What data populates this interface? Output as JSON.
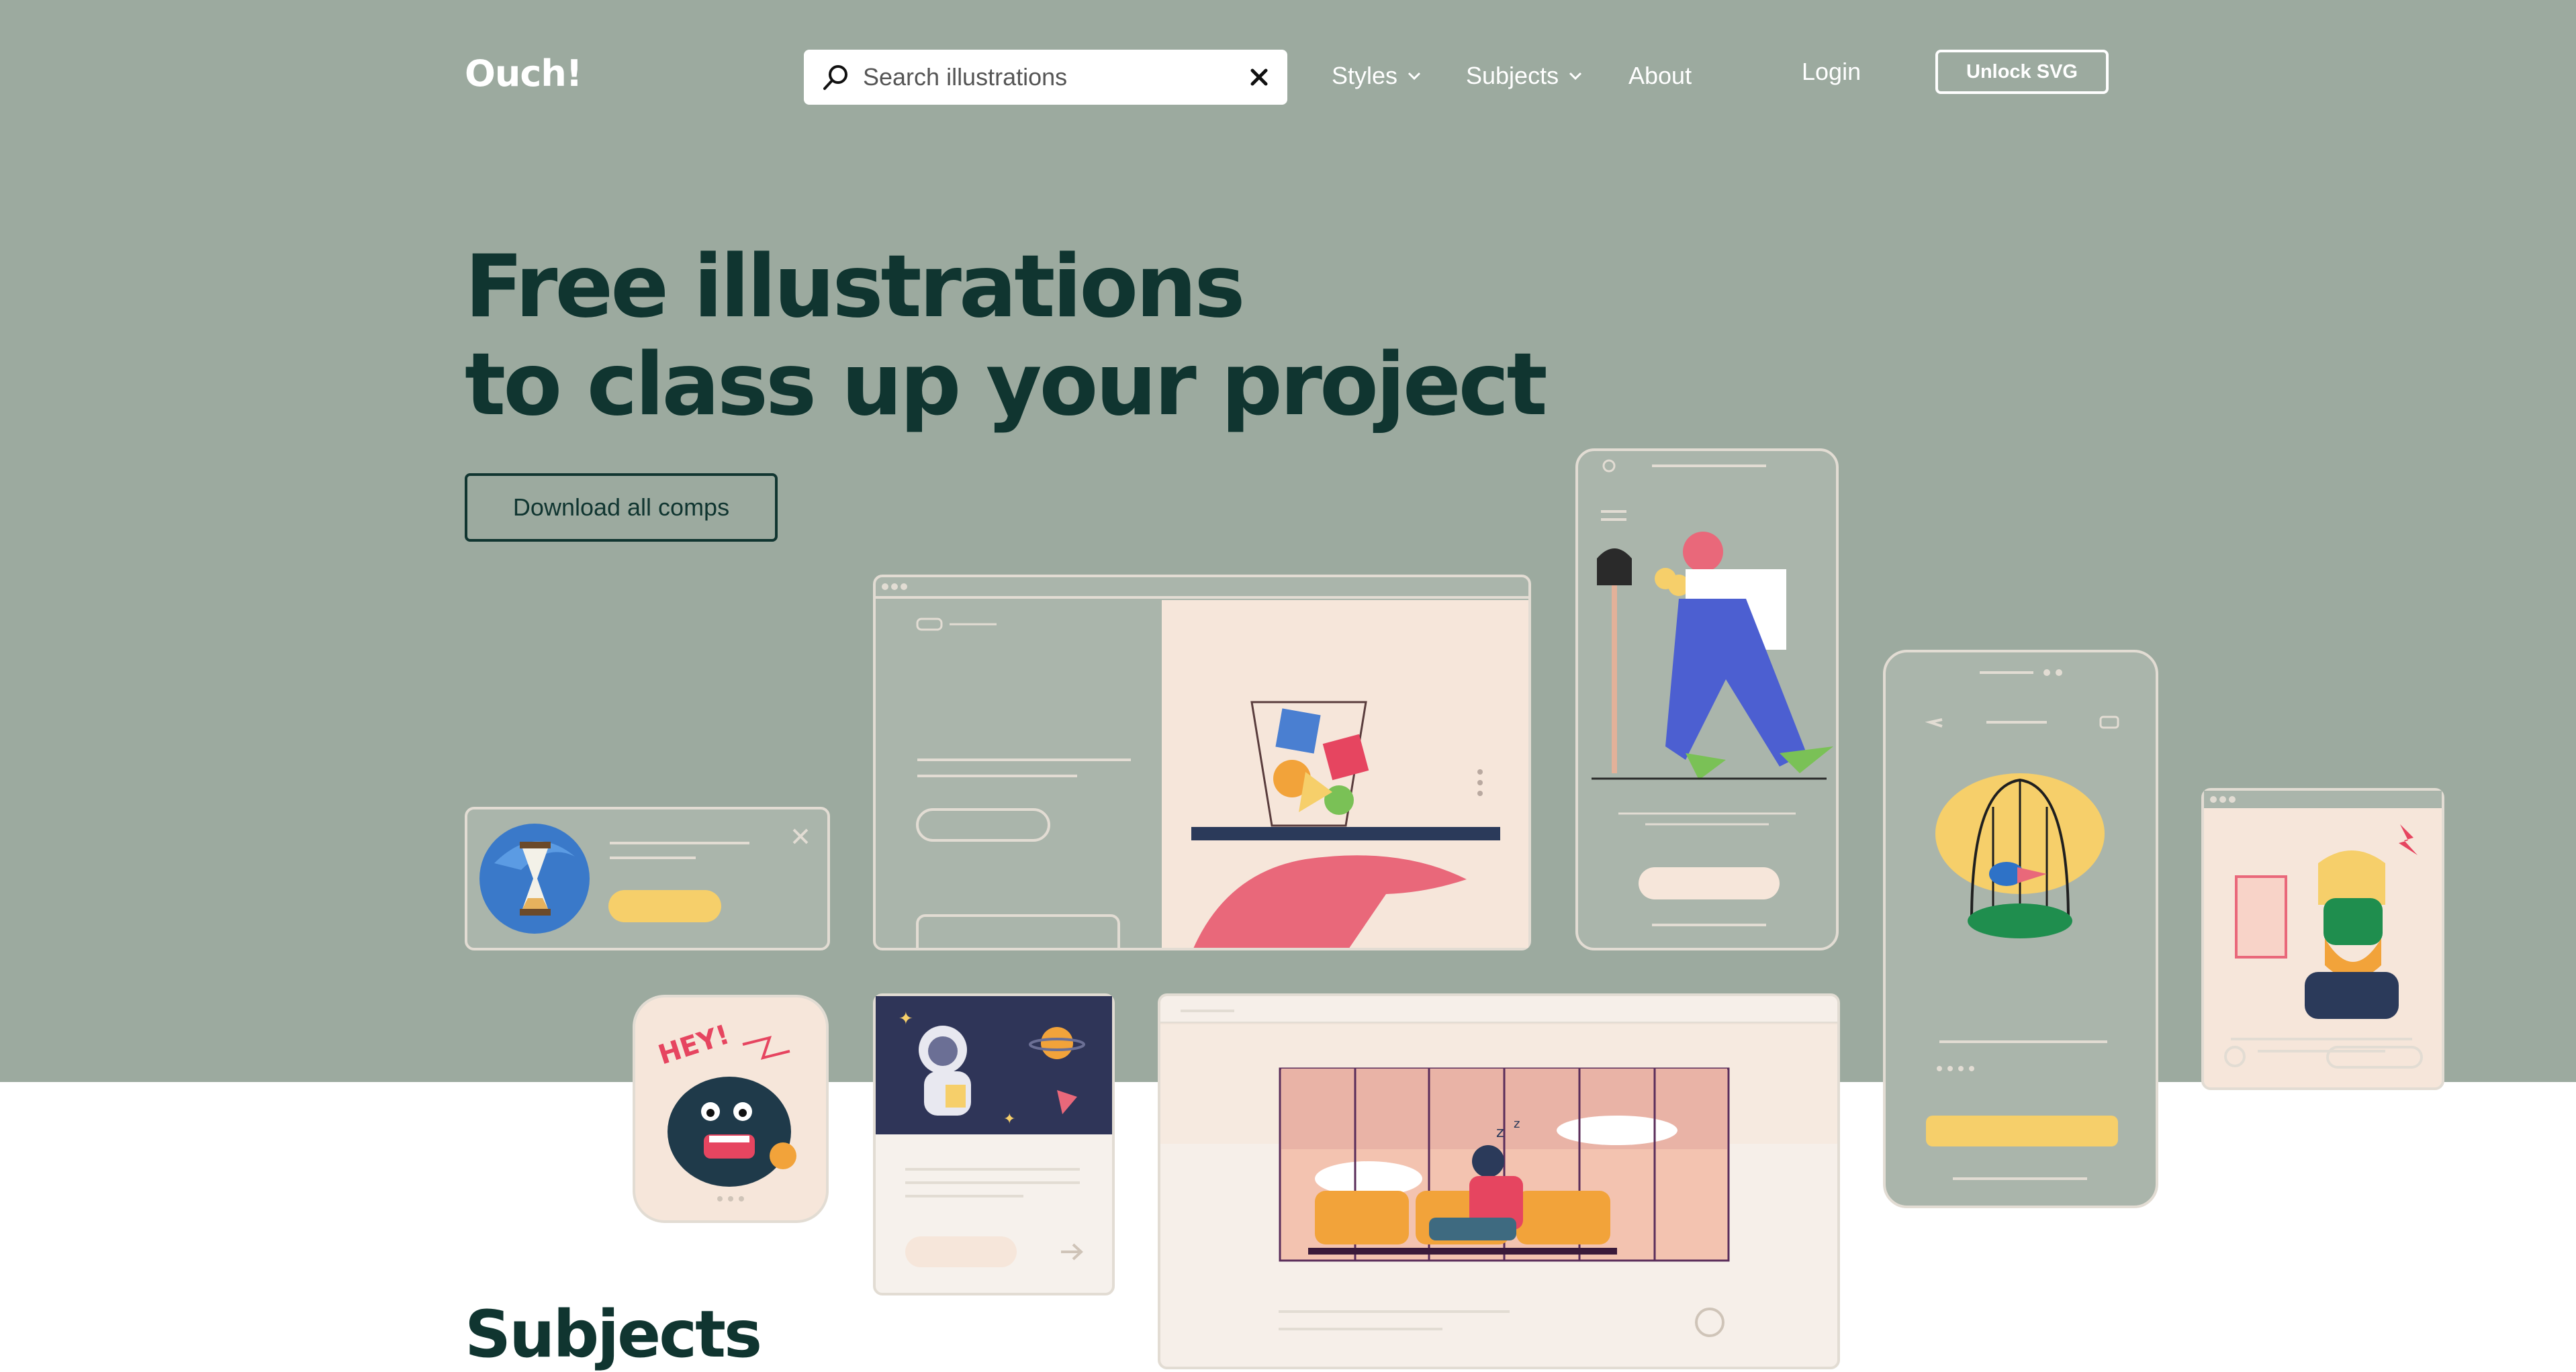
{
  "header": {
    "logo": "Ouch!",
    "search": {
      "placeholder": "Search illustrations",
      "value": ""
    },
    "nav": [
      {
        "label": "Styles",
        "has_dropdown": true
      },
      {
        "label": "Subjects",
        "has_dropdown": true
      },
      {
        "label": "About",
        "has_dropdown": false
      }
    ],
    "login_label": "Login",
    "unlock_label": "Unlock SVG"
  },
  "hero": {
    "title_line1": "Free illustrations",
    "title_line2": "to class up your project",
    "download_label": "Download all comps"
  },
  "sections": {
    "subjects_title": "Subjects"
  },
  "illustrations": [
    "hourglass-icon",
    "shopping-cart-illustration",
    "woman-with-shovel-illustration",
    "bird-cage-illustration",
    "bearded-man-illustration",
    "hey-monster-illustration",
    "astronaut-illustration",
    "sleeping-man-illustration"
  ],
  "colors": {
    "hero_bg": "#9caa9f",
    "title": "#103530",
    "mock_border": "#e2dcd3",
    "peach": "#f6e6da",
    "yellow": "#f6cf6a"
  }
}
